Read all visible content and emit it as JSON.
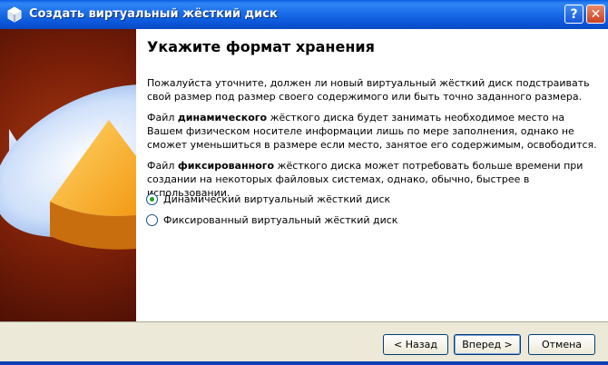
{
  "window": {
    "title": "Создать виртуальный жёсткий диск",
    "help_label": "?",
    "close_label": "✕"
  },
  "page": {
    "heading": "Укажите формат хранения",
    "para1": "Пожалуйста уточните, должен ли новый виртуальный жёсткий диск подстраивать свой размер под размер своего содержимого или быть точно заданного размера.",
    "para2": {
      "prefix": "Файл ",
      "bold": "динамического",
      "suffix": " жёсткого диска будет занимать необходимое место на Вашем физическом носителе информации лишь по мере заполнения, однако не сможет уменьшиться в размере если место, занятое его содержимым, освободится."
    },
    "para3": {
      "prefix": "Файл ",
      "bold": "фиксированного",
      "suffix": " жёсткого диска может потребовать больше времени при создании на некоторых файловых системах, однако, обычно, быстрее в использовании."
    },
    "options": [
      {
        "label": "Динамический виртуальный жёсткий диск",
        "checked": true
      },
      {
        "label": "Фиксированный виртуальный жёсткий диск",
        "checked": false
      }
    ]
  },
  "buttons": {
    "back": "< Назад",
    "next": "Вперед >",
    "cancel": "Отмена"
  }
}
